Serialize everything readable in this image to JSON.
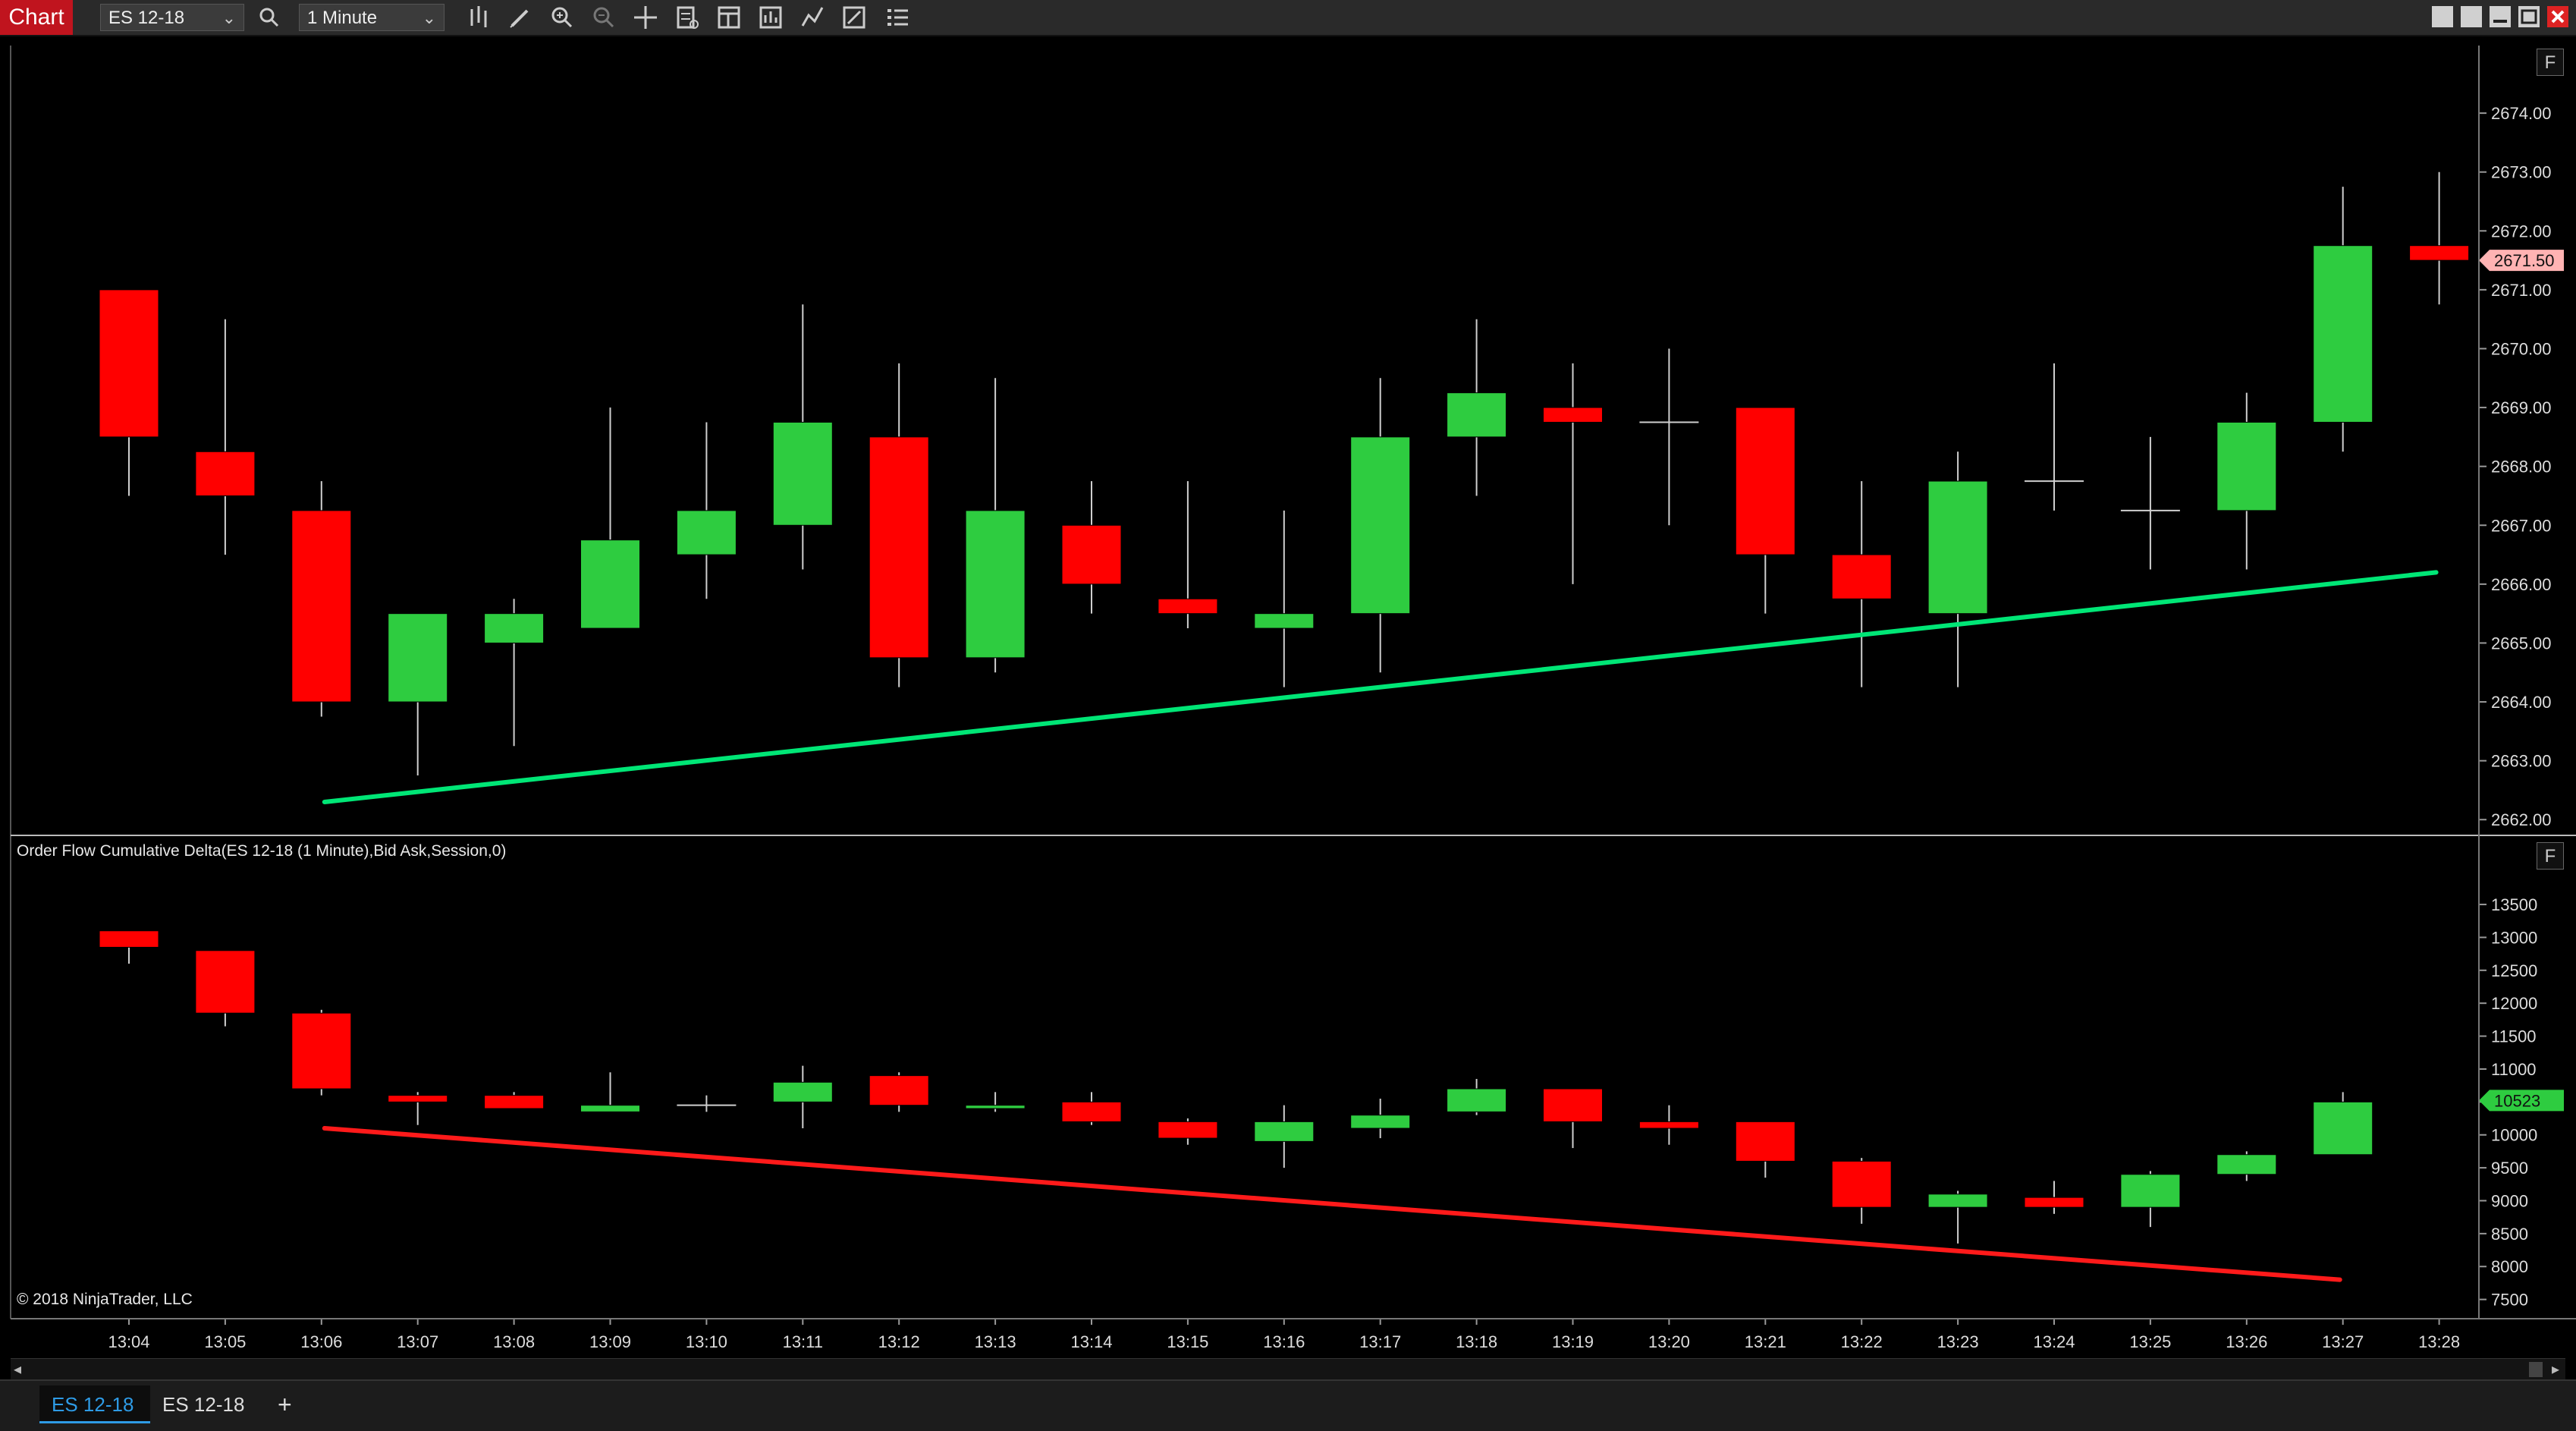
{
  "toolbar": {
    "chart_label": "Chart",
    "instrument": "ES 12-18",
    "interval": "1 Minute",
    "icons": [
      "search-icon",
      "bar-type-icon",
      "drawing-pencil-icon",
      "zoom-in-icon",
      "zoom-out-icon",
      "crosshair-icon",
      "data-box-icon",
      "templates-icon",
      "strategies-icon",
      "indicators-icon",
      "properties-icon",
      "chart-trader-icon"
    ],
    "window_controls": [
      "tile-icon",
      "restore-icon",
      "minimize-icon",
      "maximize-icon",
      "close-icon"
    ]
  },
  "price_pane": {
    "f_button": "F"
  },
  "delta_pane": {
    "label": "Order Flow Cumulative Delta(ES 12-18 (1 Minute),Bid Ask,Session,0)",
    "f_button": "F",
    "copyright": "© 2018 NinjaTrader, LLC"
  },
  "tabs": [
    {
      "label": "ES 12-18",
      "active": true
    },
    {
      "label": "ES 12-18",
      "active": false
    }
  ],
  "add_tab": "+",
  "colors": {
    "up": "#2ecc40",
    "down": "#ff0000",
    "trend_up": "#00e676",
    "trend_down": "#ff1a1a",
    "price_marker": "#ffb3b3",
    "delta_marker": "#2ecc40",
    "active_tab": "#2e9be6"
  },
  "chart_data": [
    {
      "type": "candlestick",
      "categories": [
        "13:04",
        "13:05",
        "13:06",
        "13:07",
        "13:08",
        "13:09",
        "13:10",
        "13:11",
        "13:12",
        "13:13",
        "13:14",
        "13:15",
        "13:16",
        "13:17",
        "13:18",
        "13:19",
        "13:20",
        "13:21",
        "13:22",
        "13:23",
        "13:24",
        "13:25",
        "13:26",
        "13:27",
        "13:28"
      ],
      "series": [
        {
          "open": [
            2671.0,
            2668.25,
            2667.25,
            2664.0,
            2665.0,
            2665.25,
            2666.5,
            2667.0,
            2668.5,
            2664.75,
            2667.0,
            2665.75,
            2665.25,
            2665.5,
            2668.5,
            2669.0,
            2668.75,
            2669.0,
            2666.5,
            2665.5,
            2667.75,
            2667.25,
            2667.25,
            2668.75,
            2671.75
          ],
          "high": [
            2671.0,
            2670.5,
            2667.75,
            2665.5,
            2665.75,
            2669.0,
            2668.75,
            2670.75,
            2669.75,
            2669.5,
            2667.75,
            2667.75,
            2667.25,
            2669.5,
            2670.5,
            2669.75,
            2670.0,
            2669.0,
            2667.75,
            2668.25,
            2669.75,
            2668.5,
            2669.25,
            2672.75,
            2673.0
          ],
          "low": [
            2667.5,
            2666.5,
            2663.75,
            2662.75,
            2663.25,
            2665.25,
            2665.75,
            2666.25,
            2664.25,
            2664.5,
            2665.5,
            2665.25,
            2664.25,
            2664.5,
            2667.5,
            2666.0,
            2667.0,
            2665.5,
            2664.25,
            2664.25,
            2667.25,
            2666.25,
            2666.25,
            2668.25,
            2670.75
          ],
          "close": [
            2668.5,
            2667.5,
            2664.0,
            2665.5,
            2665.5,
            2666.75,
            2667.25,
            2668.75,
            2664.75,
            2667.25,
            2666.0,
            2665.5,
            2665.5,
            2668.5,
            2669.25,
            2668.75,
            2668.75,
            2666.5,
            2665.75,
            2667.75,
            2667.75,
            2667.25,
            2668.75,
            2671.75,
            2671.5
          ]
        }
      ],
      "yticks": [
        "2662.00",
        "2663.00",
        "2664.00",
        "2665.00",
        "2666.00",
        "2667.00",
        "2668.00",
        "2669.00",
        "2670.00",
        "2671.00",
        "2672.00",
        "2673.00",
        "2674.00"
      ],
      "ylim": [
        2661.9,
        2675.2
      ],
      "last_value": "2671.50",
      "trendline": {
        "from": [
          "13:06",
          2662.3
        ],
        "to": [
          "13:28",
          2666.2
        ]
      }
    },
    {
      "type": "candlestick",
      "categories": [
        "13:04",
        "13:05",
        "13:06",
        "13:07",
        "13:08",
        "13:09",
        "13:10",
        "13:11",
        "13:12",
        "13:13",
        "13:14",
        "13:15",
        "13:16",
        "13:17",
        "13:18",
        "13:19",
        "13:20",
        "13:21",
        "13:22",
        "13:23",
        "13:24",
        "13:25",
        "13:26",
        "13:27",
        "13:28"
      ],
      "series": [
        {
          "open": [
            13100,
            12800,
            11850,
            10600,
            10600,
            10350,
            10450,
            10500,
            10900,
            10400,
            10500,
            10200,
            9900,
            10100,
            10350,
            10700,
            10200,
            10200,
            9600,
            8900,
            9050,
            8900,
            9400,
            9700
          ],
          "high": [
            13100,
            12800,
            11900,
            10650,
            10650,
            10950,
            10600,
            11050,
            10950,
            10650,
            10650,
            10250,
            10450,
            10550,
            10850,
            10700,
            10450,
            10200,
            9650,
            9150,
            9300,
            9450,
            9750,
            10650
          ],
          "low": [
            12600,
            11650,
            10600,
            10150,
            10400,
            10350,
            10350,
            10100,
            10350,
            10350,
            10150,
            9850,
            9500,
            9950,
            10300,
            9800,
            9850,
            9350,
            8650,
            8350,
            8800,
            8600,
            9300,
            9700
          ],
          "close": [
            12850,
            11850,
            10700,
            10500,
            10400,
            10450,
            10450,
            10800,
            10450,
            10450,
            10200,
            9950,
            10200,
            10300,
            10700,
            10200,
            10100,
            9600,
            8900,
            9100,
            8900,
            9400,
            9700,
            10500
          ]
        }
      ],
      "yticks": [
        "7500",
        "8000",
        "8500",
        "9000",
        "9500",
        "10000",
        "10500",
        "11000",
        "11500",
        "12000",
        "12500",
        "13000",
        "13500"
      ],
      "ylim": [
        7000,
        14100
      ],
      "last_value": "10523",
      "trendline": {
        "from": [
          "13:06",
          10100
        ],
        "to": [
          "13:27",
          7800
        ]
      }
    }
  ]
}
